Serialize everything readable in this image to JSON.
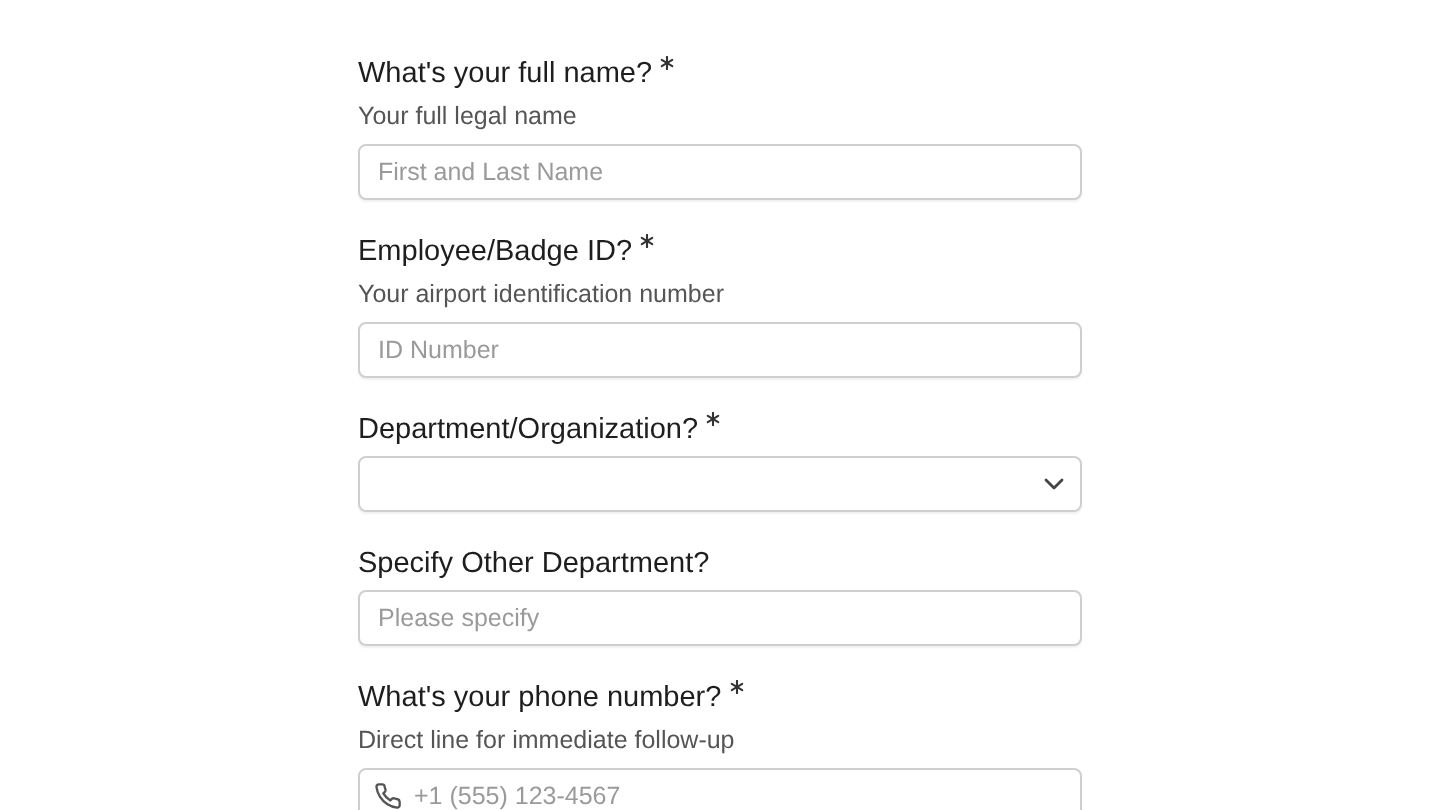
{
  "fields": [
    {
      "kind": "text",
      "label": "What's your full name?",
      "required": true,
      "hint": "Your full legal name",
      "placeholder": "First and Last Name"
    },
    {
      "kind": "text",
      "label": "Employee/Badge ID?",
      "required": true,
      "hint": "Your airport identification number",
      "placeholder": "ID Number"
    },
    {
      "kind": "select",
      "label": "Department/Organization?",
      "required": true
    },
    {
      "kind": "text",
      "label": "Specify Other Department?",
      "required": false,
      "placeholder": "Please specify"
    },
    {
      "kind": "phone",
      "label": "What's your phone number?",
      "required": true,
      "hint": "Direct line for immediate follow-up",
      "placeholder": "+1 (555) 123-4567"
    }
  ]
}
